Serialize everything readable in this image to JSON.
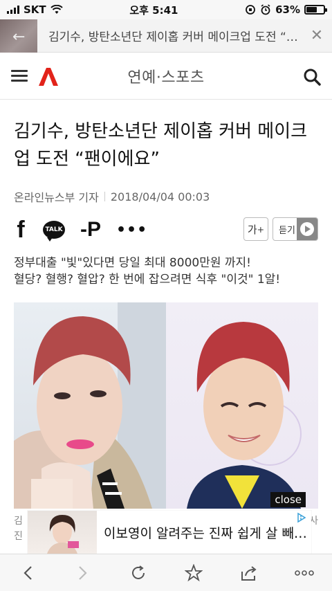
{
  "status_bar": {
    "carrier": "SKT",
    "time": "오후 5:41",
    "battery_percent": "63%",
    "battery_level": 0.63
  },
  "top_banner": {
    "title": "김기수, 방탄소년단 제이홉 커버 메이크업 도전 “팬이에요”"
  },
  "header": {
    "section_title": "연예·스포츠",
    "logo_color": "#e2231a"
  },
  "article": {
    "headline": "김기수, 방탄소년단 제이홉 커버 메이크업 도전 “팬이에요”",
    "reporter": "온라인뉴스부 기자",
    "datetime": "2018/04/04 00:03"
  },
  "share_bar": {
    "talk_label": "TALK",
    "fontsize_label": "가",
    "fontsize_plus": "+",
    "listen_label": "듣기"
  },
  "ad_text": {
    "line1": "정부대출 \"빛\"있다면 당일 최대 8000만원 까지!",
    "line2": "혈당? 혈행? 혈압? 한 번에 잡으려면 식후 \"이것\" 1알!"
  },
  "photo": {
    "close_label": "close"
  },
  "caption": {
    "line1": "김",
    "line2": "진",
    "line1_end": "사"
  },
  "ad_banner": {
    "text": "이보영이 알려주는 진짜 쉽게 살 빼는 방법"
  }
}
